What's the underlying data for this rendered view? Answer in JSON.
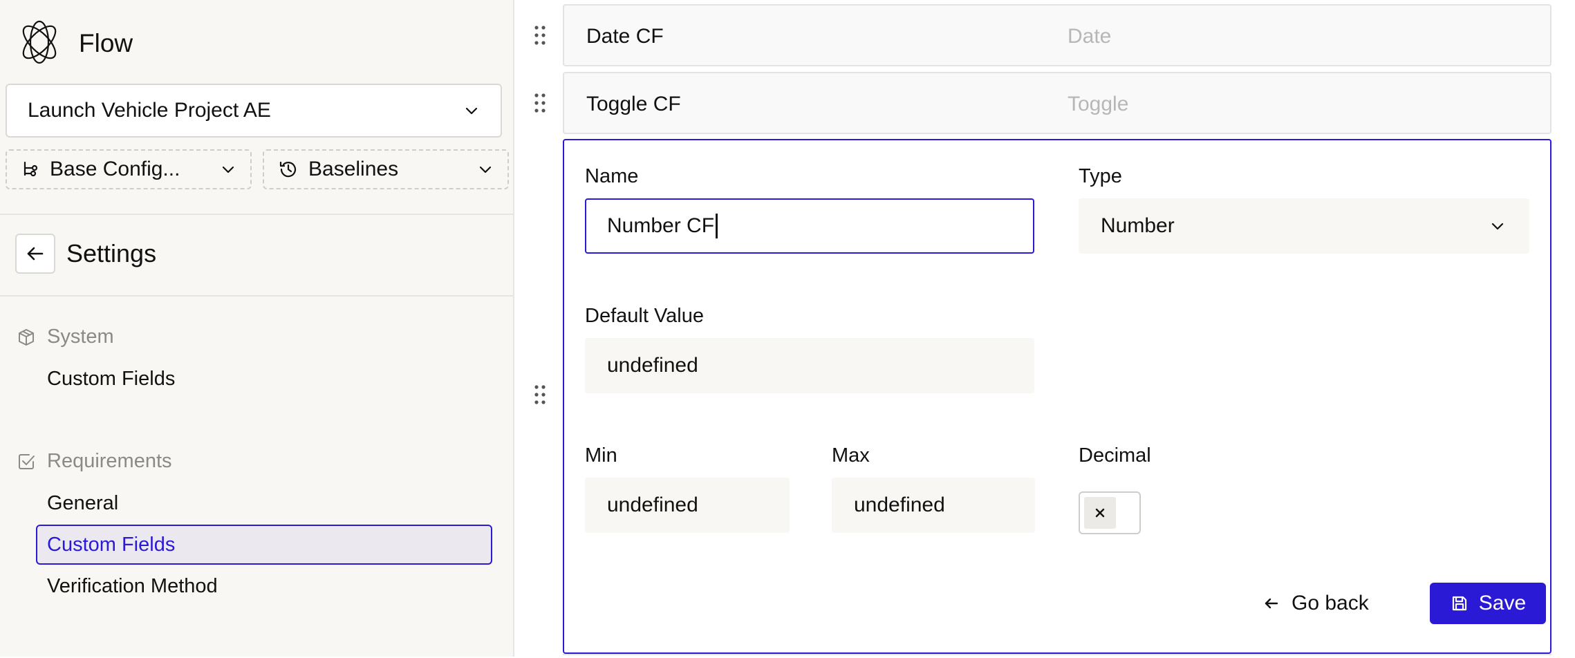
{
  "app": {
    "name": "Flow"
  },
  "project": {
    "selected": "Launch Vehicle Project AE"
  },
  "config": {
    "label": "Base Config..."
  },
  "baselines": {
    "label": "Baselines"
  },
  "settings": {
    "title": "Settings"
  },
  "sidebar": {
    "sections": [
      {
        "title": "System",
        "icon": "cube-icon",
        "items": [
          {
            "label": "Custom Fields"
          }
        ]
      },
      {
        "title": "Requirements",
        "icon": "checkbox-icon",
        "items": [
          {
            "label": "General"
          },
          {
            "label": "Custom Fields",
            "active": true
          },
          {
            "label": "Verification Method"
          }
        ]
      }
    ]
  },
  "fields": [
    {
      "name": "Date CF",
      "type": "Date"
    },
    {
      "name": "Toggle CF",
      "type": "Toggle"
    }
  ],
  "editor": {
    "name_label": "Name",
    "name_value": "Number CF",
    "type_label": "Type",
    "type_value": "Number",
    "default_label": "Default Value",
    "default_value": "undefined",
    "min_label": "Min",
    "min_value": "undefined",
    "max_label": "Max",
    "max_value": "undefined",
    "decimal_label": "Decimal",
    "decimal_checked": false,
    "goback_label": "Go back",
    "save_label": "Save"
  },
  "colors": {
    "accent": "#2a1ad6",
    "sidebar_bg": "#f8f7f4",
    "muted": "#8b8a86"
  }
}
